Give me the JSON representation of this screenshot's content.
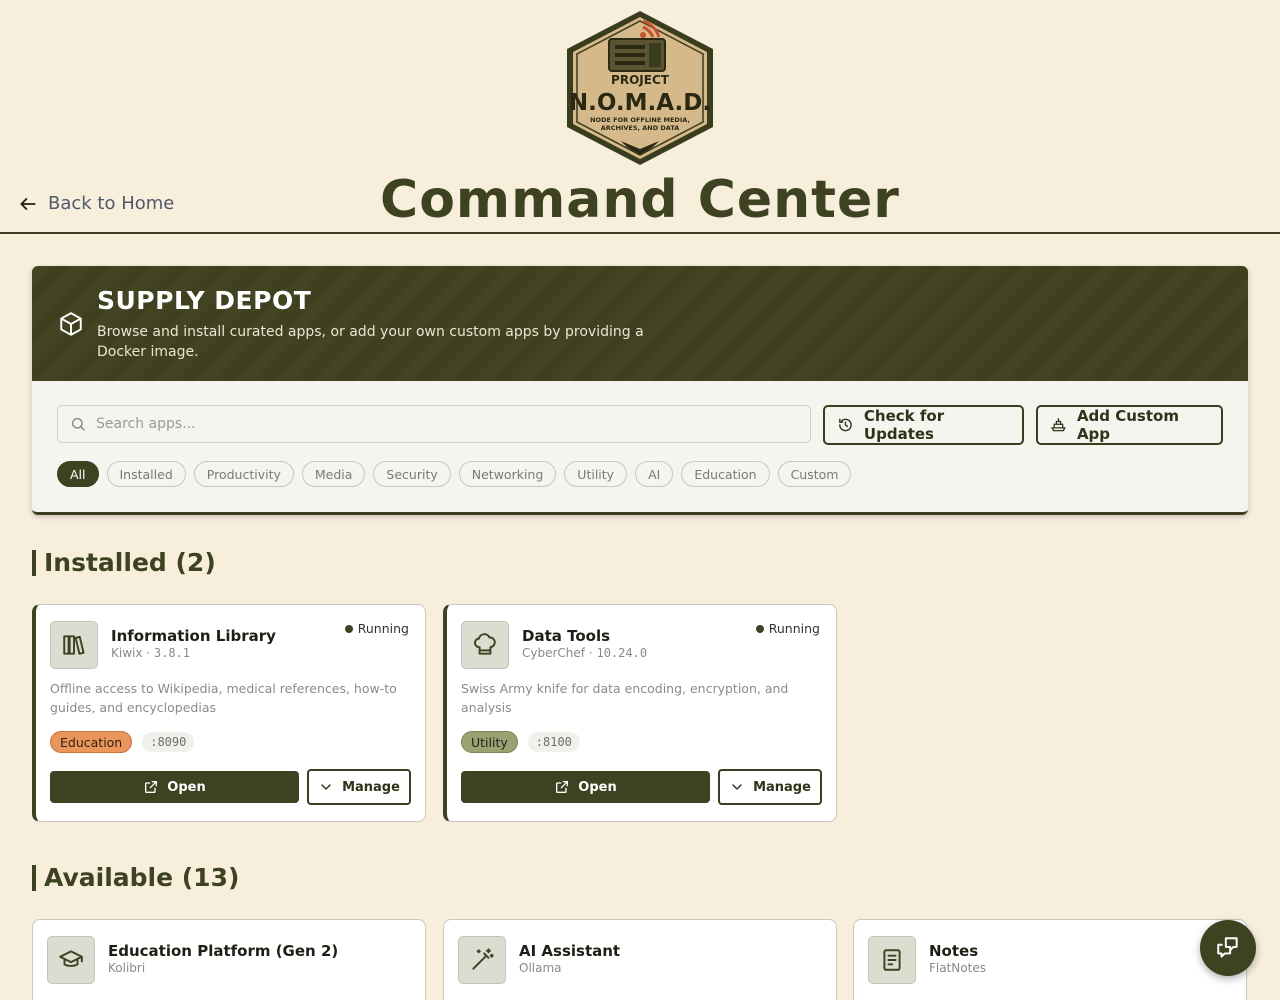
{
  "header": {
    "logo_lines": [
      "PROJECT",
      "N.O.M.A.D.",
      "NODE FOR OFFLINE MEDIA,",
      "ARCHIVES, AND DATA"
    ],
    "title": "Command Center",
    "back_label": "Back to Home"
  },
  "depot": {
    "title": "SUPPLY DEPOT",
    "description": "Browse and install curated apps, or add your own custom apps by providing a Docker image.",
    "search_placeholder": "Search apps...",
    "check_updates_label": "Check for Updates",
    "add_custom_label": "Add Custom App",
    "filters": [
      "All",
      "Installed",
      "Productivity",
      "Media",
      "Security",
      "Networking",
      "Utility",
      "AI",
      "Education",
      "Custom"
    ],
    "active_filter": "All"
  },
  "installed": {
    "heading": "Installed (2)",
    "apps": [
      {
        "name": "Information Library",
        "provider": "Kiwix",
        "version": "3.8.1",
        "status": "Running",
        "description": "Offline access to Wikipedia, medical references, how-to guides, and encyclopedias",
        "category": "Education",
        "port": ":8090",
        "open_label": "Open",
        "manage_label": "Manage",
        "icon": "books-icon"
      },
      {
        "name": "Data Tools",
        "provider": "CyberChef",
        "version": "10.24.0",
        "status": "Running",
        "description": "Swiss Army knife for data encoding, encryption, and analysis",
        "category": "Utility",
        "port": ":8100",
        "open_label": "Open",
        "manage_label": "Manage",
        "icon": "chef-hat-icon"
      }
    ]
  },
  "available": {
    "heading": "Available (13)",
    "apps": [
      {
        "name": "Education Platform (Gen 2)",
        "provider": "Kolibri",
        "icon": "graduation-cap-icon"
      },
      {
        "name": "AI Assistant",
        "provider": "Ollama",
        "icon": "magic-wand-icon"
      },
      {
        "name": "Notes",
        "provider": "FlatNotes",
        "icon": "notes-icon"
      }
    ]
  },
  "colors": {
    "background": "#f7eedc",
    "accent": "#3d4220",
    "education_tag": "#e9955c",
    "utility_tag": "#9aa272"
  }
}
